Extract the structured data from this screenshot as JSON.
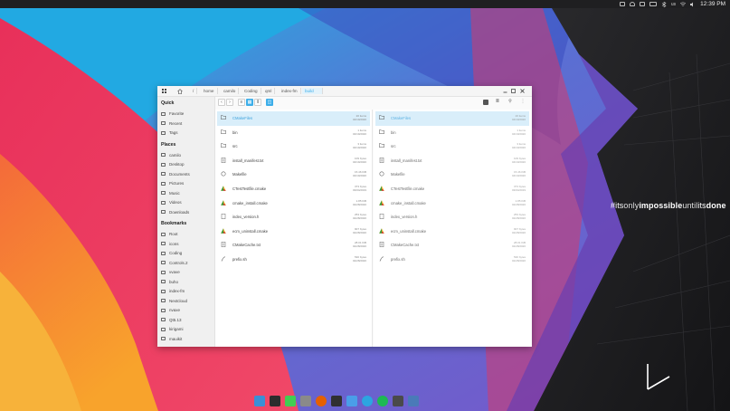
{
  "topbar": {
    "locale": "us",
    "clock": "12:39 PM",
    "tray_icons": [
      "display-icon",
      "bell-icon",
      "clipboard-icon",
      "battery-icon",
      "bluetooth-icon",
      "network-icon",
      "volume-icon"
    ]
  },
  "wallpaper": {
    "hashtag": {
      "p1": "#its",
      "p2": "only",
      "p3": "impossible",
      "p4": "until",
      "p5": "its",
      "p6": "done"
    },
    "colors": {
      "cyan": "#1fb8e3",
      "red": "#ef3a4e",
      "orange": "#f58c3a",
      "purple": "#7a55c8",
      "dark": "#1b1b1d"
    }
  },
  "window": {
    "breadcrumbs": [
      "/",
      "home",
      "camilo",
      "Coding",
      "qml",
      "index-fm",
      "build"
    ],
    "active_crumb": "build",
    "sidebar": {
      "sections": [
        {
          "title": "Quick",
          "items": [
            "Favorite",
            "Recent",
            "Tags"
          ]
        },
        {
          "title": "Places",
          "items": [
            "camilo",
            "Desktop",
            "Documents",
            "Pictures",
            "Music",
            "Videos",
            "Downloads"
          ]
        },
        {
          "title": "Bookmarks",
          "items": [
            "Root",
            "icons",
            "Coding",
            "Controls.2",
            "vvave",
            "buho",
            "index-fm",
            "Nextcloud",
            "nvaxe",
            "Qt5.13",
            "kirigami",
            "mauikit"
          ]
        }
      ]
    },
    "panes": [
      {
        "files": [
          {
            "name": "CMakeFiles",
            "size": "20 items",
            "date": "04/19/2020",
            "type": "folder",
            "selected": true
          },
          {
            "name": "bin",
            "size": "1 items",
            "date": "04/19/2020",
            "type": "folder"
          },
          {
            "name": "src",
            "size": "3 items",
            "date": "04/19/2020",
            "type": "folder"
          },
          {
            "name": "install_manifest.txt",
            "size": "109 bytes",
            "date": "04/19/2020",
            "type": "text"
          },
          {
            "name": "Makefile",
            "size": "15.46 KiB",
            "date": "04/19/2020",
            "type": "make"
          },
          {
            "name": "CTestTestfile.cmake",
            "size": "373 bytes",
            "date": "03/04/2019",
            "type": "cmake"
          },
          {
            "name": "cmake_install.cmake",
            "size": "1.85 KiB",
            "date": "02/28/2020",
            "type": "cmake"
          },
          {
            "name": "index_version.h",
            "size": "253 bytes",
            "date": "02/28/2020",
            "type": "header"
          },
          {
            "name": "ecm_uninstall.cmake",
            "size": "907 bytes",
            "date": "02/28/2020",
            "type": "cmake"
          },
          {
            "name": "CMakeCache.txt",
            "size": "28.01 KiB",
            "date": "02/28/2020",
            "type": "text"
          },
          {
            "name": "prefix.sh",
            "size": "530 bytes",
            "date": "02/28/2020",
            "type": "script"
          }
        ]
      },
      {
        "files": [
          {
            "name": "CMakeFiles",
            "size": "20 items",
            "date": "04/19/2020",
            "type": "folder",
            "selected": true
          },
          {
            "name": "bin",
            "size": "1 items",
            "date": "04/19/2020",
            "type": "folder"
          },
          {
            "name": "src",
            "size": "3 items",
            "date": "04/19/2020",
            "type": "folder"
          },
          {
            "name": "install_manifest.txt",
            "size": "109 bytes",
            "date": "04/19/2020",
            "type": "text"
          },
          {
            "name": "Makefile",
            "size": "15.46 KiB",
            "date": "04/19/2020",
            "type": "make"
          },
          {
            "name": "CTestTestfile.cmake",
            "size": "373 bytes",
            "date": "03/04/2019",
            "type": "cmake"
          },
          {
            "name": "cmake_install.cmake",
            "size": "1.85 KiB",
            "date": "02/28/2020",
            "type": "cmake"
          },
          {
            "name": "index_version.h",
            "size": "253 bytes",
            "date": "02/28/2020",
            "type": "header"
          },
          {
            "name": "ecm_uninstall.cmake",
            "size": "907 bytes",
            "date": "02/28/2020",
            "type": "cmake"
          },
          {
            "name": "CMakeCache.txt",
            "size": "28.01 KiB",
            "date": "02/28/2020",
            "type": "text"
          },
          {
            "name": "prefix.sh",
            "size": "530 bytes",
            "date": "02/28/2020",
            "type": "script"
          }
        ]
      }
    ],
    "accent": "#3daee9"
  },
  "dock": {
    "apps": [
      {
        "name": "folder-app-icon",
        "color": "#3b8fd6"
      },
      {
        "name": "terminal-app-icon",
        "color": "#2d2d2d"
      },
      {
        "name": "qtcreator-app-icon",
        "color": "#41cd52"
      },
      {
        "name": "settings-app-icon",
        "color": "#8a8a8a"
      },
      {
        "name": "firefox-app-icon",
        "color": "#e66000"
      },
      {
        "name": "konsole-app-icon",
        "color": "#303030"
      },
      {
        "name": "discover-app-icon",
        "color": "#4a9ee8"
      },
      {
        "name": "telegram-app-icon",
        "color": "#2ca5e0"
      },
      {
        "name": "spotify-app-icon",
        "color": "#1db954"
      },
      {
        "name": "nextcloud-app-icon",
        "color": "#4a4a4a"
      },
      {
        "name": "krita-app-icon",
        "color": "#4a7ab8"
      }
    ]
  }
}
